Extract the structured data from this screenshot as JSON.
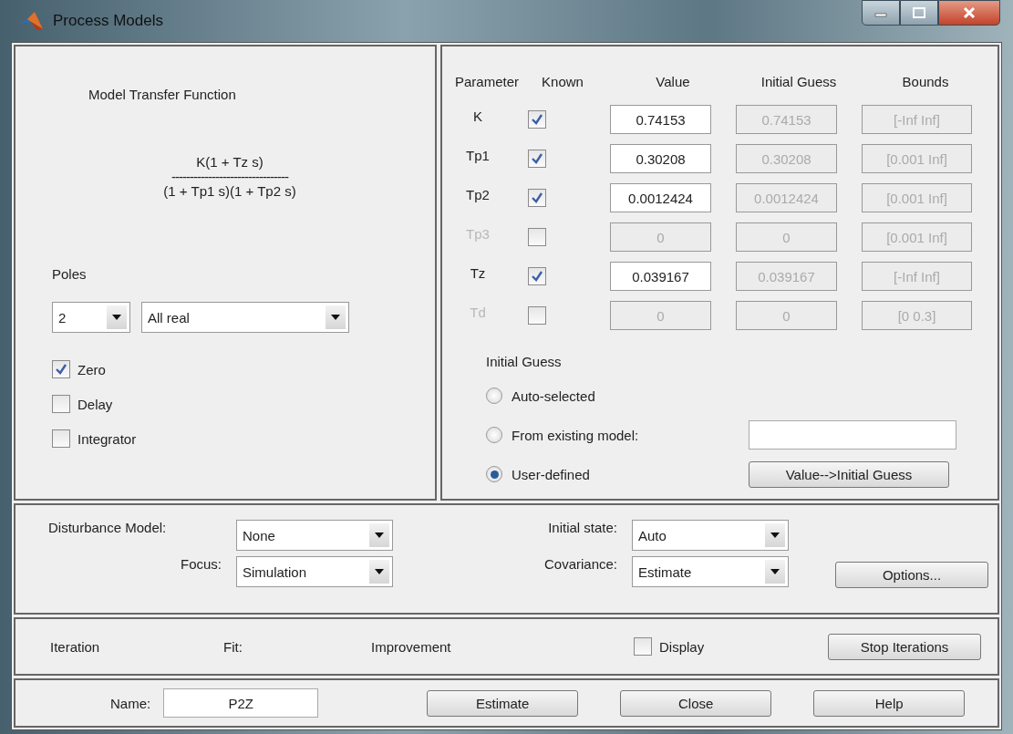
{
  "window": {
    "title": "Process Models"
  },
  "transfer_function": {
    "title": "Model Transfer Function",
    "numerator": "K(1 + Tz s)",
    "fraction_line": "--------------------------------",
    "denominator": "(1 + Tp1 s)(1 + Tp2 s)"
  },
  "poles": {
    "label": "Poles",
    "count": "2",
    "type": "All real"
  },
  "structure_options": [
    {
      "label": "Zero",
      "checked": true
    },
    {
      "label": "Delay",
      "checked": false
    },
    {
      "label": "Integrator",
      "checked": false
    }
  ],
  "parameters": {
    "columns": [
      "Parameter",
      "Known",
      "Value",
      "Initial Guess",
      "Bounds"
    ],
    "rows": [
      {
        "name": "K",
        "enabled": true,
        "known": true,
        "value": "0.74153",
        "initial_guess": "0.74153",
        "bounds": "[-Inf Inf]"
      },
      {
        "name": "Tp1",
        "enabled": true,
        "known": true,
        "value": "0.30208",
        "initial_guess": "0.30208",
        "bounds": "[0.001 Inf]"
      },
      {
        "name": "Tp2",
        "enabled": true,
        "known": true,
        "value": "0.0012424",
        "initial_guess": "0.0012424",
        "bounds": "[0.001 Inf]"
      },
      {
        "name": "Tp3",
        "enabled": false,
        "known": false,
        "value": "0",
        "initial_guess": "0",
        "bounds": "[0.001 Inf]"
      },
      {
        "name": "Tz",
        "enabled": true,
        "known": true,
        "value": "0.039167",
        "initial_guess": "0.039167",
        "bounds": "[-Inf Inf]"
      },
      {
        "name": "Td",
        "enabled": false,
        "known": false,
        "value": "0",
        "initial_guess": "0",
        "bounds": "[0 0.3]"
      }
    ]
  },
  "initial_guess": {
    "title": "Initial Guess",
    "choices": [
      {
        "label": "Auto-selected",
        "selected": false
      },
      {
        "label": "From existing model:",
        "selected": false
      },
      {
        "label": "User-defined",
        "selected": true
      }
    ],
    "button": "Value-->Initial Guess"
  },
  "estimation": {
    "disturbance_label": "Disturbance Model:",
    "disturbance": "None",
    "focus_label": "Focus:",
    "focus": "Simulation",
    "initial_state_label": "Initial state:",
    "initial_state": "Auto",
    "covariance_label": "Covariance:",
    "covariance": "Estimate",
    "options_button": "Options..."
  },
  "iteration": {
    "labels": [
      "Iteration",
      "Fit:",
      "Improvement"
    ],
    "display": {
      "label": "Display",
      "checked": false
    },
    "button": "Stop Iterations"
  },
  "footer": {
    "name_label": "Name:",
    "name_value": "P2Z",
    "buttons": [
      "Estimate",
      "Close",
      "Help"
    ]
  }
}
